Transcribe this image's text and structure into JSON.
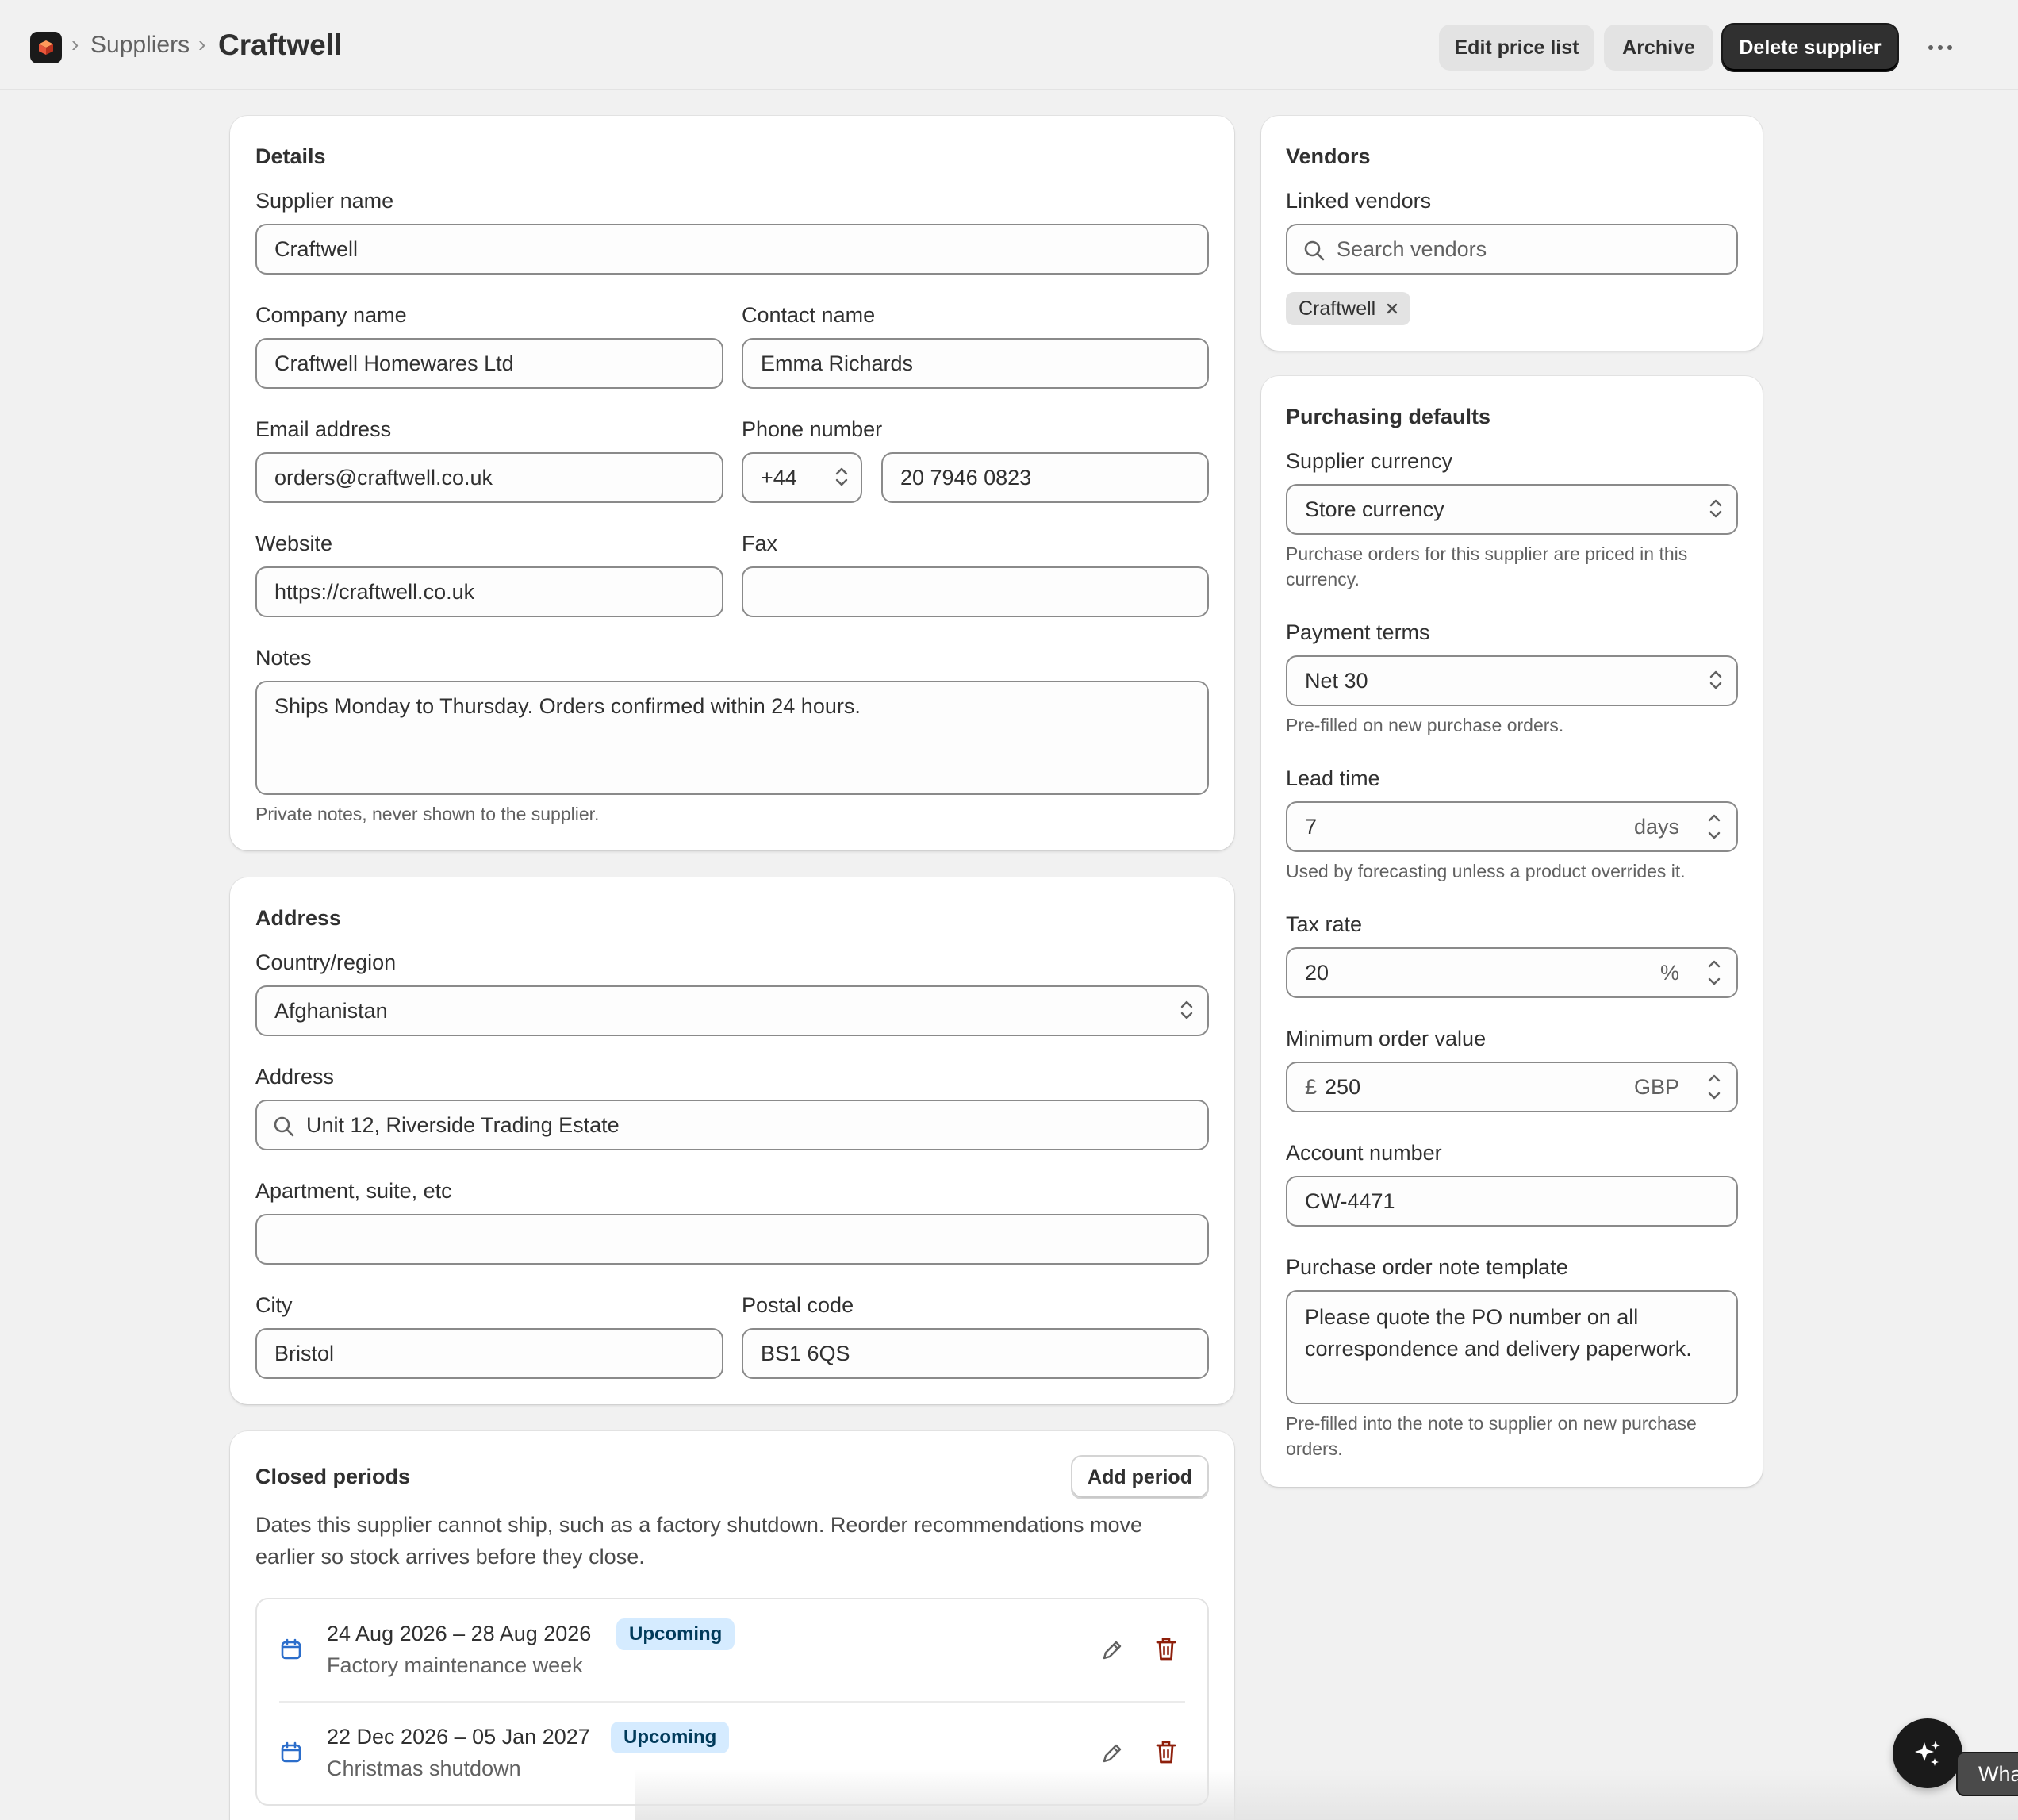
{
  "header": {
    "breadcrumb_parent": "Suppliers",
    "title": "Craftwell",
    "edit_price_list_label": "Edit price list",
    "archive_label": "Archive",
    "delete_label": "Delete supplier"
  },
  "details": {
    "title": "Details",
    "supplier_name_label": "Supplier name",
    "supplier_name_value": "Craftwell",
    "company_name_label": "Company name",
    "company_name_value": "Craftwell Homewares Ltd",
    "contact_name_label": "Contact name",
    "contact_name_value": "Emma Richards",
    "email_label": "Email address",
    "email_value": "orders@craftwell.co.uk",
    "phone_label": "Phone number",
    "phone_code": "+44",
    "phone_value": "20 7946 0823",
    "website_label": "Website",
    "website_value": "https://craftwell.co.uk",
    "fax_label": "Fax",
    "fax_value": "",
    "notes_label": "Notes",
    "notes_value": "Ships Monday to Thursday. Orders confirmed within 24 hours.",
    "notes_help": "Private notes, never shown to the supplier."
  },
  "address": {
    "title": "Address",
    "country_label": "Country/region",
    "country_value": "Afghanistan",
    "address_label": "Address",
    "address_value": "Unit 12, Riverside Trading Estate",
    "apartment_label": "Apartment, suite, etc",
    "apartment_value": "",
    "city_label": "City",
    "city_value": "Bristol",
    "postal_label": "Postal code",
    "postal_value": "BS1 6QS"
  },
  "closed_periods": {
    "title": "Closed periods",
    "add_label": "Add period",
    "description": "Dates this supplier cannot ship, such as a factory shutdown. Reorder recommendations move earlier so stock arrives before they close.",
    "items": [
      {
        "dates": "24 Aug 2026 – 28 Aug 2026",
        "status": "Upcoming",
        "name": "Factory maintenance week"
      },
      {
        "dates": "22 Dec 2026 – 05 Jan 2027",
        "status": "Upcoming",
        "name": "Christmas shutdown"
      }
    ]
  },
  "vendors": {
    "title": "Vendors",
    "linked_label": "Linked vendors",
    "search_placeholder": "Search vendors",
    "tags": [
      "Craftwell"
    ]
  },
  "purchasing": {
    "title": "Purchasing defaults",
    "currency_label": "Supplier currency",
    "currency_value": "Store currency",
    "currency_help": "Purchase orders for this supplier are priced in this currency.",
    "payment_label": "Payment terms",
    "payment_value": "Net 30",
    "payment_help": "Pre-filled on new purchase orders.",
    "lead_label": "Lead time",
    "lead_value": "7",
    "lead_suffix": "days",
    "lead_help": "Used by forecasting unless a product overrides it.",
    "tax_label": "Tax rate",
    "tax_value": "20",
    "tax_suffix": "%",
    "min_label": "Minimum order value",
    "min_prefix": "£",
    "min_value": "250",
    "min_suffix": "GBP",
    "account_label": "Account number",
    "account_value": "CW-4471",
    "po_note_label": "Purchase order note template",
    "po_note_value": "Please quote the PO number on all correspondence and delivery paperwork.",
    "po_note_help": "Pre-filled into the note to supplier on new purchase orders."
  },
  "assistant": {
    "pill_text": "Wha"
  },
  "colors": {
    "page_bg": "#f1f1f1",
    "card_bg": "#ffffff",
    "primary_button": "#303030",
    "badge_bg": "#d5ebff",
    "delete_icon": "#8e1f0b",
    "calendar_icon": "#2c6ecb"
  }
}
